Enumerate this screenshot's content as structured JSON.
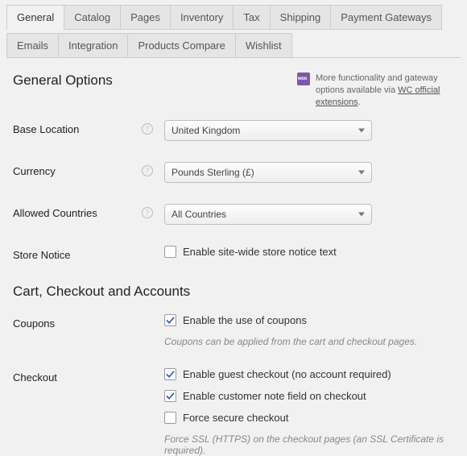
{
  "tabs": {
    "items": [
      {
        "label": "General",
        "active": true
      },
      {
        "label": "Catalog"
      },
      {
        "label": "Pages"
      },
      {
        "label": "Inventory"
      },
      {
        "label": "Tax"
      },
      {
        "label": "Shipping"
      },
      {
        "label": "Payment Gateways"
      },
      {
        "label": "Emails"
      },
      {
        "label": "Integration"
      },
      {
        "label": "Products Compare"
      },
      {
        "label": "Wishlist"
      }
    ]
  },
  "section1_title": "General Options",
  "promo": {
    "text_before": "More functionality and gateway options available via ",
    "link": "WC official extensions",
    "text_after": "."
  },
  "base_location": {
    "label": "Base Location",
    "value": "United Kingdom"
  },
  "currency": {
    "label": "Currency",
    "value": "Pounds Sterling (£)"
  },
  "allowed_countries": {
    "label": "Allowed Countries",
    "value": "All Countries"
  },
  "store_notice": {
    "label": "Store Notice",
    "checkbox": "Enable site-wide store notice text"
  },
  "section2_title": "Cart, Checkout and Accounts",
  "coupons": {
    "label": "Coupons",
    "checkbox": "Enable the use of coupons",
    "hint": "Coupons can be applied from the cart and checkout pages."
  },
  "checkout": {
    "label": "Checkout",
    "c1": "Enable guest checkout (no account required)",
    "c2": "Enable customer note field on checkout",
    "c3": "Force secure checkout",
    "hint": "Force SSL (HTTPS) on the checkout pages (an SSL Certificate is required)."
  }
}
